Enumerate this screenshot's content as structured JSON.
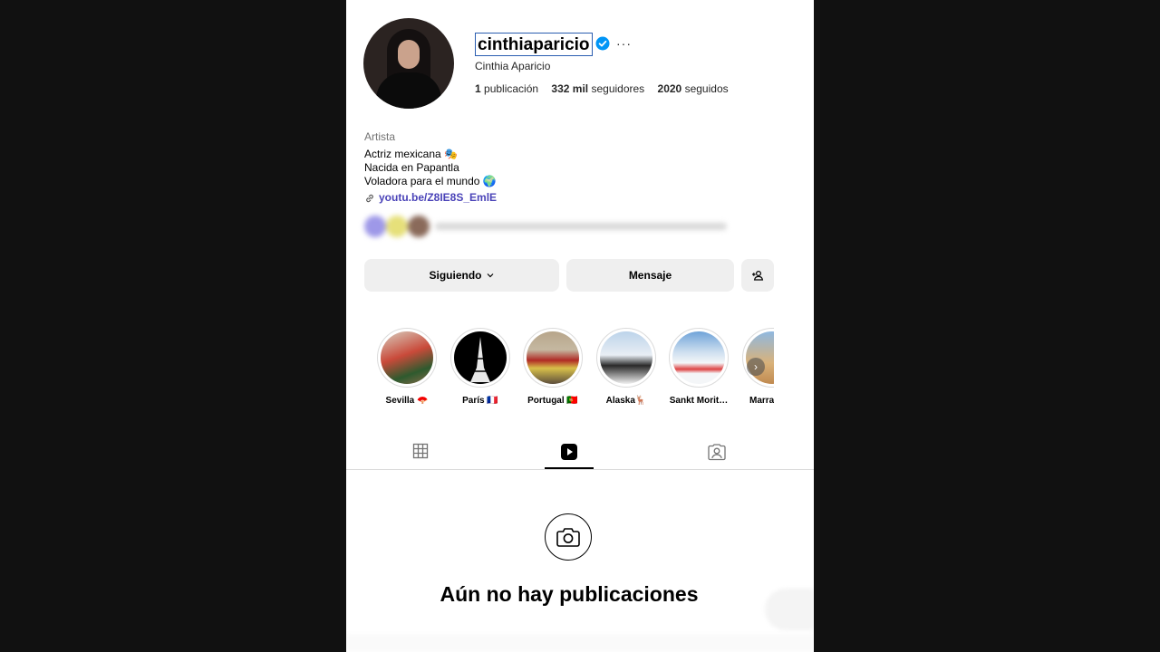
{
  "profile": {
    "username": "cinthiaparicio",
    "full_name": "Cinthia Aparicio",
    "stats": {
      "posts_value": "1",
      "posts_label": "publicación",
      "followers_value": "332 mil",
      "followers_label": "seguidores",
      "following_value": "2020",
      "following_label": "seguidos"
    },
    "category": "Artista",
    "bio_lines": [
      "Actriz mexicana 🎭",
      "Nacida en Papantla",
      "Voladora para el mundo 🌍"
    ],
    "link": "youtu.be/Z8IE8S_EmlE",
    "verified_color": "#0095f6"
  },
  "actions": {
    "following_label": "Siguiendo",
    "message_label": "Mensaje"
  },
  "highlights": [
    {
      "label": "Sevilla 🪭"
    },
    {
      "label": "París 🇫🇷"
    },
    {
      "label": "Portugal 🇵🇹"
    },
    {
      "label": "Alaska🦌"
    },
    {
      "label": "Sankt Morit…"
    },
    {
      "label": "Marrakech"
    }
  ],
  "tabs": [
    "grid-icon",
    "reels-icon",
    "tagged-icon"
  ],
  "empty_state": {
    "title": "Aún no hay publicaciones"
  }
}
